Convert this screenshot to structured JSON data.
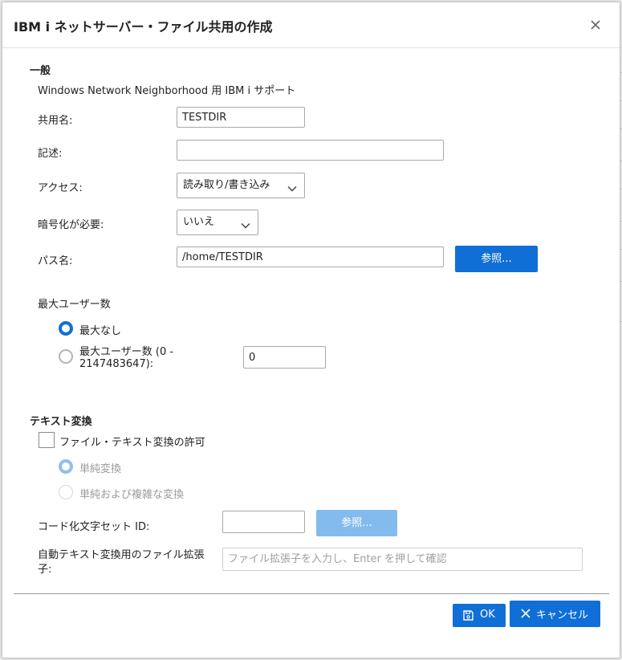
{
  "dialog": {
    "title": "IBM i ネットサーバー・ファイル共用の作成",
    "close_icon": "close-icon"
  },
  "general": {
    "heading": "一般",
    "subtitle": "Windows Network Neighborhood 用 IBM i サポート",
    "share_name_label": "共用名:",
    "share_name_value": "TESTDIR",
    "description_label": "記述:",
    "description_value": "",
    "access_label": "アクセス:",
    "access_value": "読み取り/書き込み",
    "encryption_label": "暗号化が必要:",
    "encryption_value": "いいえ",
    "path_label": "パス名:",
    "path_value": "/home/TESTDIR",
    "browse_label": "参照..."
  },
  "max_users": {
    "heading": "最大ユーザー数",
    "option_none": "最大なし",
    "option_limit_line1": "最大ユーザー数 (0 -",
    "option_limit_line2": "2147483647):",
    "limit_value": "0",
    "selected": "none"
  },
  "text_conversion": {
    "heading": "テキスト変換",
    "allow_label": "ファイル・テキスト変換の許可",
    "allow_checked": false,
    "simple_label": "単純変換",
    "complex_label": "単純および複雑な変換",
    "ccsid_label": "コード化文字セット ID:",
    "ccsid_value": "",
    "browse_label": "参照...",
    "ext_label_line1": "自動テキスト変換用のファイル拡張",
    "ext_label_line2": "子:",
    "ext_placeholder": "ファイル拡張子を入力し、Enter を押して確認"
  },
  "footer": {
    "ok_label": "OK",
    "cancel_label": "キャンセル"
  },
  "colors": {
    "primary": "#0f6fd6",
    "primary_disabled": "#84bbee"
  }
}
